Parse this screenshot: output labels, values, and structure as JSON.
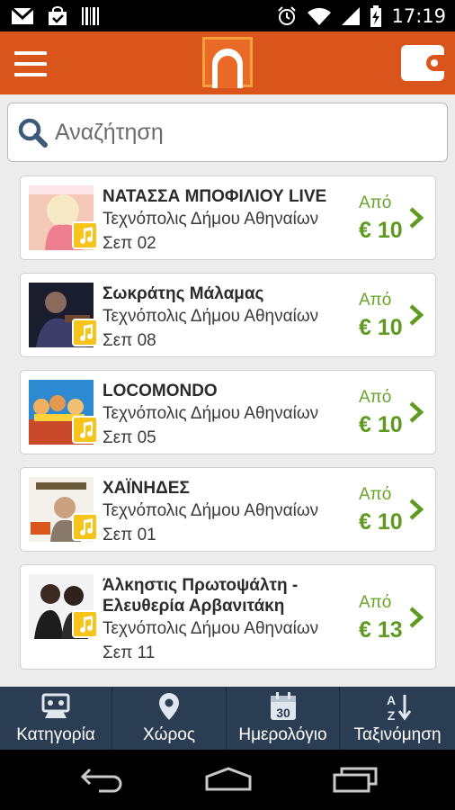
{
  "status_bar": {
    "time": "17:19",
    "icons": [
      "gmail-icon",
      "bag-check-icon",
      "barcode-icon",
      "alarm-icon",
      "wifi-icon",
      "signal-icon",
      "battery-charging-icon"
    ]
  },
  "app_bar": {
    "accent": "#d9551c",
    "menu_icon": "hamburger-icon",
    "logo_icon": "venue-logo-icon",
    "wallet_icon": "wallet-icon"
  },
  "search": {
    "placeholder": "Αναζήτηση",
    "icon": "search-icon"
  },
  "events": [
    {
      "title": "ΝΑΤΑΣΣΑ ΜΠΟΦΙΛΙΟΥ LIVE",
      "venue": "Τεχνόπολις Δήμου Αθηναίων",
      "date": "Σεπ 02",
      "price_label": "Από",
      "price": "€ 10",
      "category_icon": "music-note-icon"
    },
    {
      "title": "Σωκράτης Μάλαμας",
      "venue": "Τεχνόπολις Δήμου Αθηναίων",
      "date": "Σεπ 08",
      "price_label": "Από",
      "price": "€ 10",
      "category_icon": "music-note-icon"
    },
    {
      "title": "LOCOMONDO",
      "venue": "Τεχνόπολις Δήμου Αθηναίων",
      "date": "Σεπ 05",
      "price_label": "Από",
      "price": "€ 10",
      "category_icon": "music-note-icon"
    },
    {
      "title": "ΧΑΪΝΗΔΕΣ",
      "venue": "Τεχνόπολις Δήμου Αθηναίων",
      "date": "Σεπ 01",
      "price_label": "Από",
      "price": "€ 10",
      "category_icon": "music-note-icon"
    },
    {
      "title_line1": "Άλκηστις Πρωτοψάλτη -",
      "title_line2": "Ελευθερία Αρβανιτάκη",
      "venue": "Τεχνόπολις Δήμου Αθηναίων",
      "date": "Σεπ 11",
      "price_label": "Από",
      "price": "€ 13",
      "category_icon": "music-note-icon"
    }
  ],
  "tabs": [
    {
      "label": "Κατηγορία",
      "icon": "category-icon"
    },
    {
      "label": "Χώρος",
      "icon": "location-pin-icon"
    },
    {
      "label": "Ημερολόγιο",
      "icon": "calendar-icon",
      "icon_text": "30"
    },
    {
      "label": "Ταξινόμηση",
      "icon": "sort-az-icon",
      "icon_text_top": "A",
      "icon_text_bottom": "Z"
    }
  ],
  "nav_bar": {
    "icons": [
      "back-icon",
      "home-icon",
      "recent-apps-icon"
    ]
  },
  "colors": {
    "price_green": "#5d9a1f",
    "tab_bar": "#2a3d52",
    "badge_yellow": "#f6c41a"
  }
}
